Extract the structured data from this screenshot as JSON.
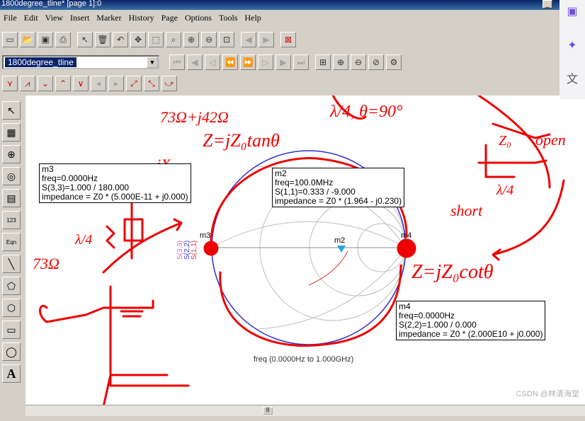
{
  "window": {
    "title": "1800degree_tline* [page 1]:0"
  },
  "menu": [
    "File",
    "Edit",
    "View",
    "Insert",
    "Marker",
    "History",
    "Page",
    "Options",
    "Tools",
    "Help"
  ],
  "toolbar2": {
    "page_select": "1800degree_tline"
  },
  "chart_data": {
    "type": "smith",
    "sweep_label": "freq (0.0000Hz to 1.000GHz)",
    "traces": [
      "S(3,3)",
      "S(2,2)",
      "S(1,1)"
    ],
    "trace_colors": [
      "#cc66cc",
      "#3333cc",
      "#cc3333"
    ],
    "markers": [
      {
        "name": "m3",
        "lines": [
          "m3",
          "freq=0.0000Hz",
          "S(3,3)=1.000 / 180.000",
          "impedance = Z0 * (5.000E-11 + j0.000)"
        ]
      },
      {
        "name": "m2",
        "lines": [
          "m2",
          "freq=100.0MHz",
          "S(1,1)=0.333 / -9.000",
          "impedance = Z0 * (1.964 - j0.230)"
        ]
      },
      {
        "name": "m4",
        "lines": [
          "m4",
          "freq=0.0000Hz",
          "S(2,2)=1.000 / 0.000",
          "impedance = Z0 * (2.000E10 + j0.000)"
        ]
      }
    ],
    "marker_labels": [
      "m3",
      "m2",
      "m4"
    ]
  },
  "annotations": {
    "top_center_1": "73Ω+j42Ω",
    "top_center_2": "Z=jZ₀tanθ",
    "top_right_1": "λ/4, θ=90°",
    "right_open": "open",
    "right_z0": "Z₀",
    "right_short": "short",
    "right_cot": "Z=jZ₀cotθ",
    "left_jx": "jX",
    "left_73": "73Ω",
    "left_lambda": "λ/4",
    "right_lambda": "λ/4"
  },
  "watermark": "CSDN @林清海堂"
}
